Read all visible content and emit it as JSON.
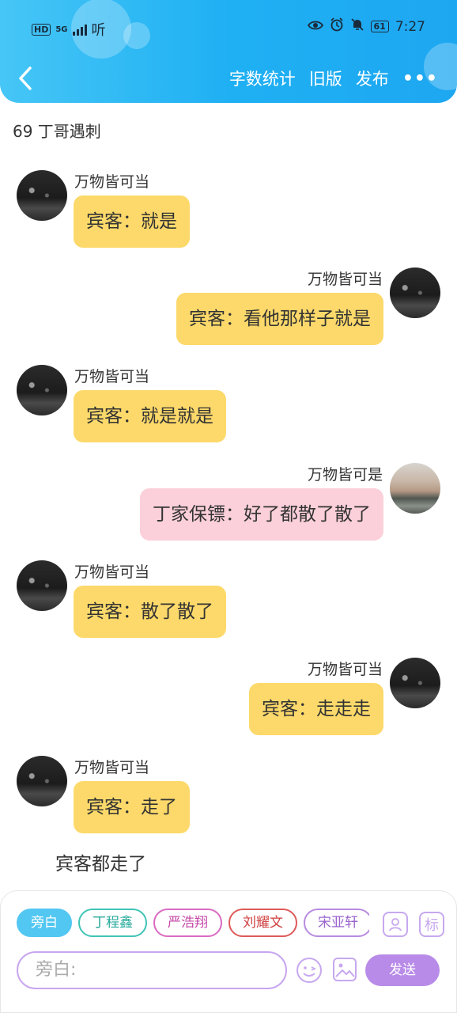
{
  "status_bar": {
    "left_label": "HD",
    "network": "5G",
    "sound_label": "听",
    "battery": "61",
    "time": "7:27"
  },
  "nav": {
    "word_count": "字数统计",
    "old_version": "旧版",
    "publish": "发布",
    "more": "•••"
  },
  "title": "69 丁哥遇刺",
  "messages": [
    {
      "side": "left",
      "name": "万物皆可当",
      "text": "宾客：就是",
      "color": "yellow"
    },
    {
      "side": "right",
      "name": "万物皆可当",
      "text": "宾客：看他那样子就是",
      "color": "yellow"
    },
    {
      "side": "left",
      "name": "万物皆可当",
      "text": "宾客：就是就是",
      "color": "yellow"
    },
    {
      "side": "right",
      "name": "万物皆可是",
      "text": "丁家保镖：好了都散了散了",
      "color": "pink"
    },
    {
      "side": "left",
      "name": "万物皆可当",
      "text": "宾客：散了散了",
      "color": "yellow"
    },
    {
      "side": "right",
      "name": "万物皆可当",
      "text": "宾客：走走走",
      "color": "yellow"
    },
    {
      "side": "left",
      "name": "万物皆可当",
      "text": "宾客：走了",
      "color": "yellow"
    }
  ],
  "narration": "宾客都走了",
  "input_panel": {
    "chips": [
      "旁白",
      "丁程鑫",
      "严浩翔",
      "刘耀文",
      "宋亚轩"
    ],
    "tool_mark": "标",
    "placeholder": "旁白:",
    "send_label": "发送"
  },
  "colors": {
    "header": "#1fb0f3",
    "bubble_yellow": "#fcd96a",
    "bubble_pink": "#fbd0da",
    "accent_purple": "#b88be8"
  }
}
